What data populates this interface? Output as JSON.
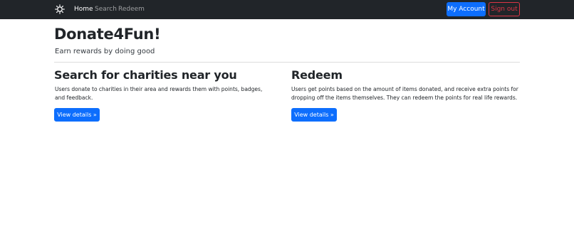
{
  "navbar": {
    "brand_icon": "sun-gear-icon",
    "links": [
      {
        "label": "Home",
        "active": true
      },
      {
        "label": "Search",
        "active": false
      },
      {
        "label": "Redeem",
        "active": false
      }
    ],
    "account_label": "My Account",
    "signout_label": "Sign out",
    "colors": {
      "background": "#212529",
      "primary": "#0d6efd",
      "danger": "#dc3545"
    }
  },
  "hero": {
    "title": "Donate4Fun!",
    "subtitle": "Earn rewards by doing good"
  },
  "columns": [
    {
      "heading": "Search for charities near you",
      "text": "Users donate to charities in their area and rewards them with points, badges, and feedback.",
      "button_label": "View details »"
    },
    {
      "heading": "Redeem",
      "text": "Users get points based on the amount of items donated, and receive extra points for dropping off the items themselves. They can redeem the points for real life rewards.",
      "button_label": "View details »"
    }
  ]
}
